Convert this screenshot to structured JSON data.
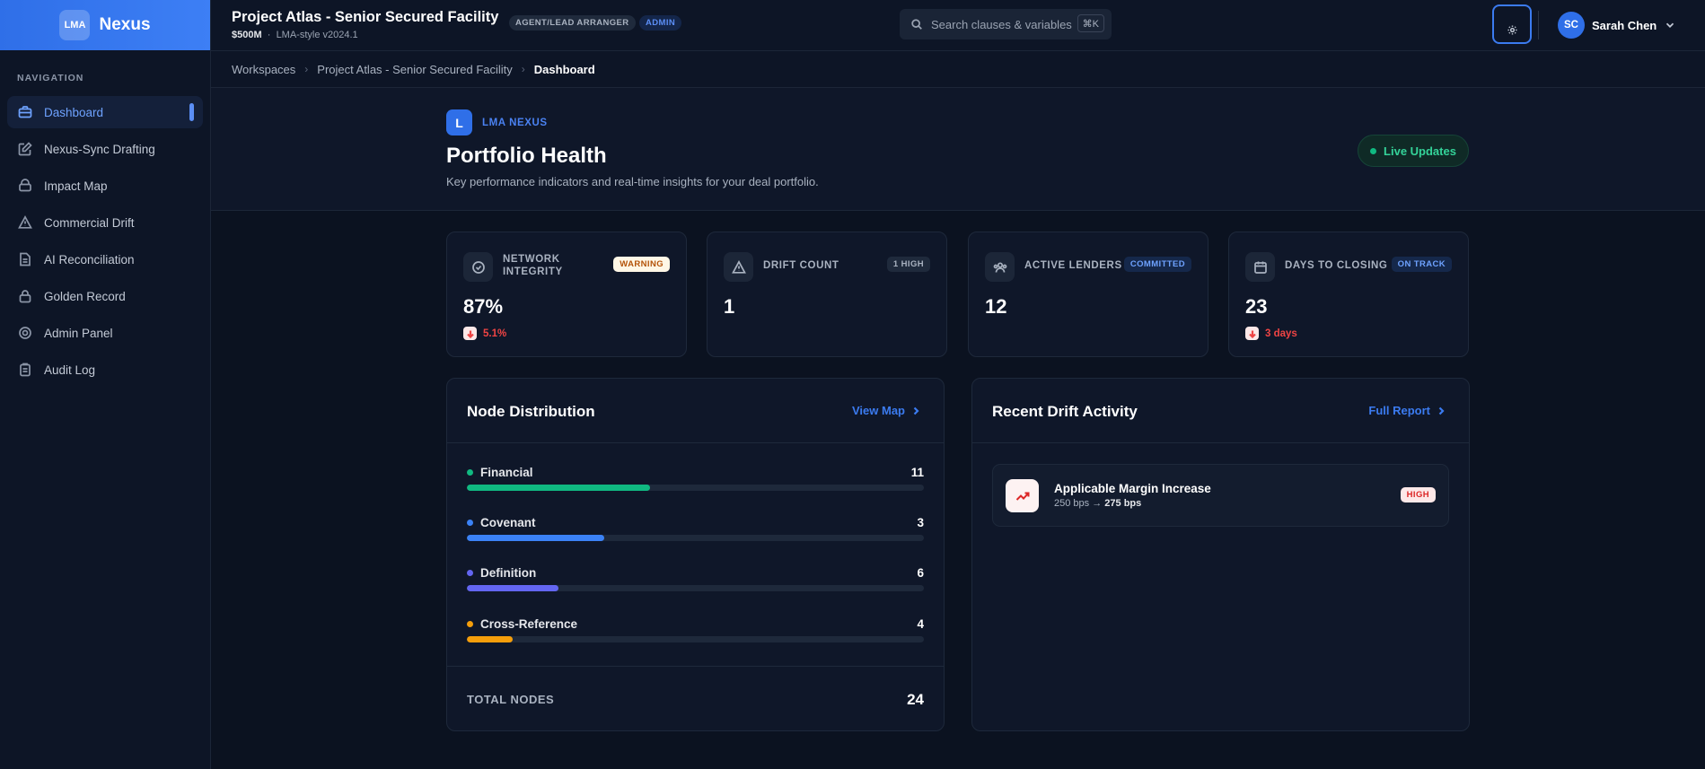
{
  "brand": {
    "logo": "LMA",
    "name": "Nexus"
  },
  "nav": {
    "heading": "NAVIGATION",
    "items": [
      {
        "label": "Dashboard",
        "icon": "briefcase-icon",
        "active": true
      },
      {
        "label": "Nexus-Sync Drafting",
        "icon": "edit-icon"
      },
      {
        "label": "Impact Map",
        "icon": "layers-icon"
      },
      {
        "label": "Commercial Drift",
        "icon": "warning-icon"
      },
      {
        "label": "AI Reconciliation",
        "icon": "document-icon"
      },
      {
        "label": "Golden Record",
        "icon": "lock-icon"
      },
      {
        "label": "Admin Panel",
        "icon": "gear-icon"
      },
      {
        "label": "Audit Log",
        "icon": "clipboard-icon"
      }
    ]
  },
  "header": {
    "title": "Project Atlas - Senior Secured Facility",
    "amount": "$500M",
    "separator": "·",
    "version": "LMA-style v2024.1",
    "role_tag": "AGENT/LEAD ARRANGER",
    "admin_tag": "ADMIN",
    "search_placeholder": "Search clauses & variables",
    "search_shortcut": "⌘K",
    "user_initials": "SC",
    "user_name": "Sarah Chen"
  },
  "breadcrumb": [
    "Workspaces",
    "Project Atlas - Senior Secured Facility",
    "Dashboard"
  ],
  "hero": {
    "logo": "L",
    "kicker": "LMA NEXUS",
    "title": "Portfolio Health",
    "description": "Key performance indicators and real-time insights for your deal portfolio.",
    "live_label": "Live Updates"
  },
  "kpis": [
    {
      "label": "NETWORK INTEGRITY",
      "badge": "WARNING",
      "value": "87%",
      "delta": "5.1%"
    },
    {
      "label": "DRIFT COUNT",
      "badge": "1 HIGH",
      "value": "1"
    },
    {
      "label": "ACTIVE LENDERS",
      "badge": "COMMITTED",
      "value": "12"
    },
    {
      "label": "DAYS TO CLOSING",
      "badge": "ON TRACK",
      "value": "23",
      "delta": "3 days"
    }
  ],
  "node_distribution": {
    "title": "Node Distribution",
    "link": "View Map",
    "rows": [
      {
        "name": "Financial",
        "count": 11,
        "fraction": 0.4,
        "color": "#10b981"
      },
      {
        "name": "Covenant",
        "count": 3,
        "fraction": 0.3,
        "color": "#3b82f6"
      },
      {
        "name": "Definition",
        "count": 6,
        "fraction": 0.2,
        "color": "#6366f1"
      },
      {
        "name": "Cross-Reference",
        "count": 4,
        "fraction": 0.1,
        "color": "#f59e0b"
      }
    ],
    "total_label": "TOTAL NODES",
    "total_value": "24"
  },
  "drift_activity": {
    "title": "Recent Drift Activity",
    "link": "Full Report",
    "items": [
      {
        "title": "Applicable Margin Increase",
        "from": "250 bps",
        "arrow": "→",
        "to": "275 bps",
        "severity": "HIGH"
      }
    ]
  }
}
